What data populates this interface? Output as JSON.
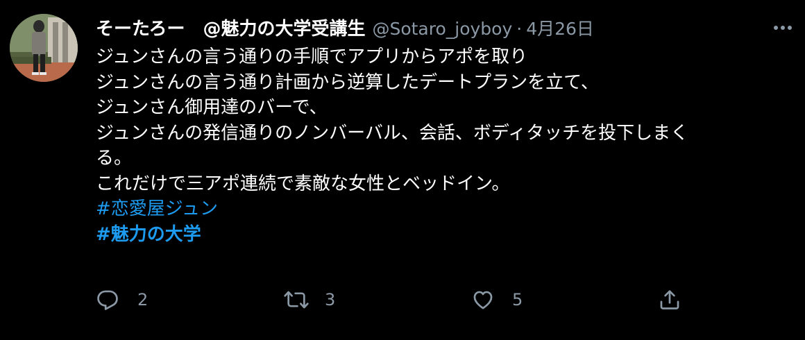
{
  "tweet": {
    "display_name": "そーたろー　@魅力の大学受講生",
    "screen_name": "@Sotaro_joyboy",
    "separator": "·",
    "date": "4月26日",
    "lines": [
      "ジュンさんの言う通りの手順でアプリからアポを取り",
      "ジュンさんの言う通り計画から逆算したデートプランを立て、",
      "ジュンさん御用達のバーで、",
      "ジュンさんの発信通りのノンバーバル、会話、ボディタッチを投下しまく",
      "る。",
      "これだけで三アポ連続で素敵な女性とベッドイン。"
    ],
    "hashtags": [
      "#恋愛屋ジュン",
      "#魅力の大学"
    ],
    "actions": {
      "reply_count": "2",
      "retweet_count": "3",
      "like_count": "5"
    }
  },
  "icons": {
    "avatar": "profile-photo",
    "more": "more-icon",
    "reply": "reply-icon",
    "retweet": "retweet-icon",
    "like": "heart-icon",
    "share": "share-icon"
  },
  "colors": {
    "background": "#000000",
    "text": "#ffffff",
    "secondary": "#8b98a5",
    "link": "#1d9bf0"
  }
}
